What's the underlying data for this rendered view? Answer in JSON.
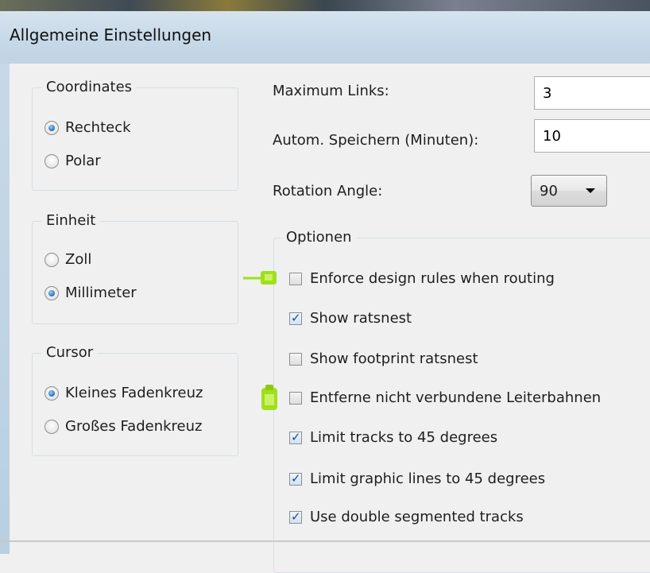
{
  "window": {
    "title": "Allgemeine Einstellungen"
  },
  "coordinates": {
    "legend": "Coordinates",
    "options": [
      {
        "label": "Rechteck",
        "checked": true
      },
      {
        "label": "Polar",
        "checked": false
      }
    ]
  },
  "einheit": {
    "legend": "Einheit",
    "options": [
      {
        "label": "Zoll",
        "checked": false
      },
      {
        "label": "Millimeter",
        "checked": true
      }
    ]
  },
  "cursor": {
    "legend": "Cursor",
    "options": [
      {
        "label": "Kleines Fadenkreuz",
        "checked": true
      },
      {
        "label": "Großes Fadenkreuz",
        "checked": false
      }
    ]
  },
  "fields": {
    "max_links": {
      "label": "Maximum Links:",
      "value": "3"
    },
    "autosave": {
      "label": "Autom. Speichern (Minuten):",
      "value": "10"
    },
    "rotation": {
      "label": "Rotation Angle:",
      "value": "90"
    }
  },
  "optionen": {
    "legend": "Optionen",
    "items": [
      {
        "label": "Enforce design rules when routing",
        "checked": false
      },
      {
        "label": "Show ratsnest",
        "checked": true
      },
      {
        "label": "Show footprint ratsnest",
        "checked": false
      },
      {
        "label": "Entferne nicht verbundene Leiterbahnen",
        "checked": false
      },
      {
        "label": "Limit tracks to 45 degrees",
        "checked": true
      },
      {
        "label": "Limit graphic lines to 45 degrees",
        "checked": true
      },
      {
        "label": "Use double segmented tracks",
        "checked": true
      }
    ]
  },
  "colors": {
    "marker": "#9fe01a",
    "accent": "#1e6fb8"
  }
}
